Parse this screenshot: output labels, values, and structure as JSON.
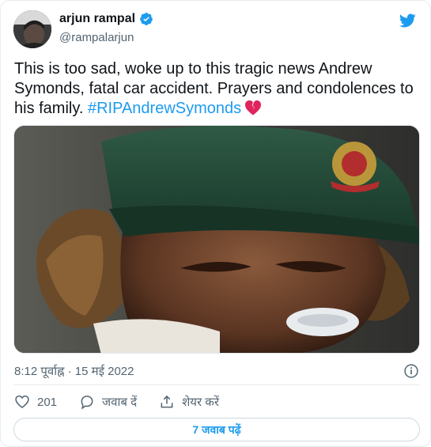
{
  "user": {
    "display_name": "arjun rampal",
    "handle": "@rampalarjun",
    "verified": true
  },
  "tweet": {
    "text": "This is too sad, woke up to this tragic news Andrew Symonds, fatal car accident. Prayers and condolences to his family. ",
    "hashtag": "#RIPAndrewSymonds",
    "emoji": "broken-heart"
  },
  "meta": {
    "timestamp": "8:12 पूर्वाह्न · 15 मई 2022"
  },
  "actions": {
    "like_count": "201",
    "reply_label": "जवाब दें",
    "share_label": "शेयर करें"
  },
  "read_replies_label": "7 जवाब पढ़ें",
  "colors": {
    "accent": "#1d9bf0",
    "secondary_text": "#536471",
    "broken_heart": "#e0245e"
  }
}
